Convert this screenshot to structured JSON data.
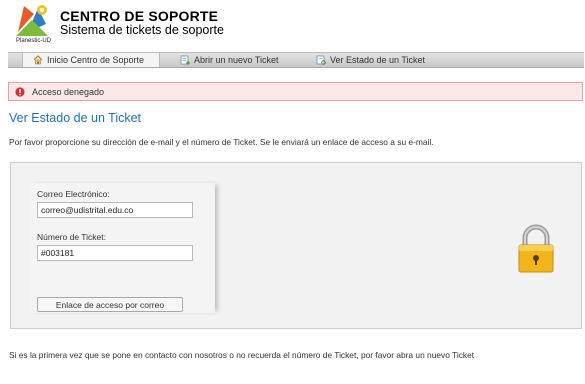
{
  "header": {
    "brand_title": "CENTRO DE SOPORTE",
    "brand_subtitle": "Sistema de tickets de soporte",
    "logo_caption": "Planestic-UD"
  },
  "nav": {
    "items": [
      {
        "label": "Inicio Centro de Soporte",
        "icon": "home-icon",
        "active": true
      },
      {
        "label": "Abrir un nuevo Ticket",
        "icon": "new-ticket-icon",
        "active": false
      },
      {
        "label": "Ver Estado de un Ticket",
        "icon": "ticket-status-icon",
        "active": false
      }
    ]
  },
  "alert": {
    "text": "Acceso denegado",
    "icon": "error-icon",
    "color": "#cc3333"
  },
  "page": {
    "title": "Ver Estado de un Ticket",
    "intro": "Por favor proporcione su dirección de e-mail y el número de Ticket. Se le enviará un enlace de acceso a su e-mail."
  },
  "form": {
    "email_label": "Correo Electrónico:",
    "email_value": "correo@udistrital.edu.co",
    "ticket_label": "Número de Ticket:",
    "ticket_value": "#003181",
    "submit_label": "Enlace de acceso por correo",
    "lock_icon": "padlock-icon"
  },
  "footer": {
    "text": "Si es la primera vez que se pone en contacto con nosotros o no recuerda el número de Ticket, por favor abra un nuevo Ticket"
  },
  "colors": {
    "accent": "#1d70b8",
    "alert_bg": "#fce8e8",
    "alert_border": "#e3a2a2",
    "lock_gold": "#f2b51c"
  }
}
